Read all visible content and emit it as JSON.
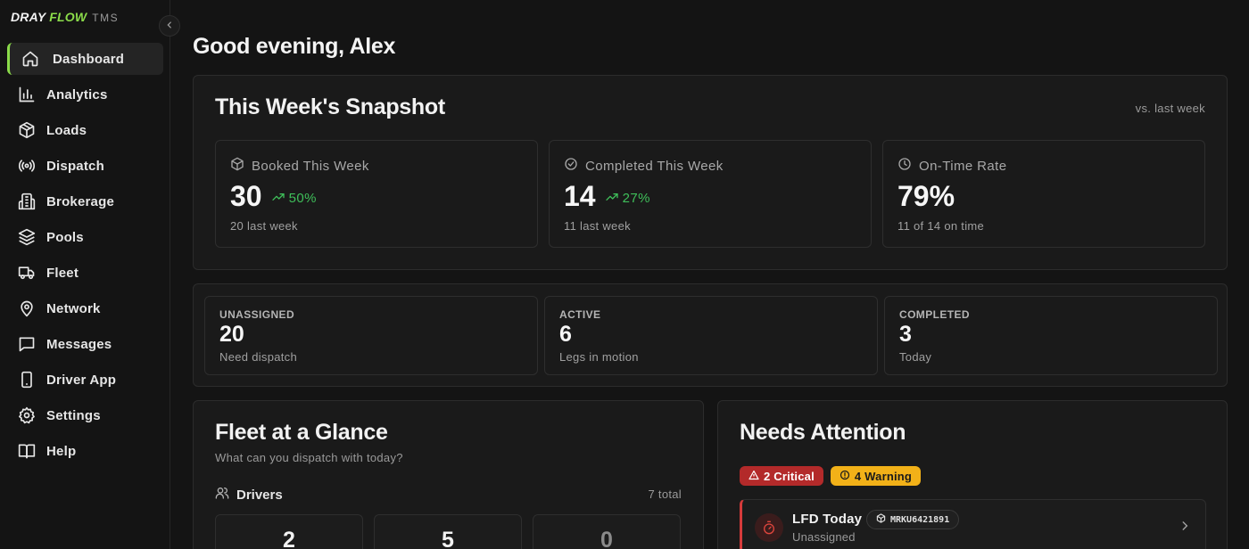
{
  "app": {
    "brand_part1": "DRAY ",
    "brand_part2": "FLOW",
    "product": "TMS",
    "accent_color": "#8bdc4a"
  },
  "sidebar": {
    "items": [
      {
        "label": "Dashboard",
        "icon": "home-icon",
        "active": true
      },
      {
        "label": "Analytics",
        "icon": "bar-chart-icon"
      },
      {
        "label": "Loads",
        "icon": "package-icon"
      },
      {
        "label": "Dispatch",
        "icon": "radio-icon"
      },
      {
        "label": "Brokerage",
        "icon": "building-icon"
      },
      {
        "label": "Pools",
        "icon": "layers-icon"
      },
      {
        "label": "Fleet",
        "icon": "truck-icon"
      },
      {
        "label": "Network",
        "icon": "map-pin-icon"
      },
      {
        "label": "Messages",
        "icon": "message-square-icon"
      },
      {
        "label": "Driver App",
        "icon": "smartphone-icon"
      },
      {
        "label": "Settings",
        "icon": "gear-icon"
      },
      {
        "label": "Help",
        "icon": "book-icon"
      }
    ]
  },
  "greeting": "Good evening, Alex",
  "snapshot": {
    "title": "This Week's Snapshot",
    "compare_label": "vs. last week",
    "cards": [
      {
        "label": "Booked This Week",
        "icon": "package-icon",
        "value": "30",
        "trend": "50%",
        "sub": "20 last week"
      },
      {
        "label": "Completed This Week",
        "icon": "check-circle-icon",
        "value": "14",
        "trend": "27%",
        "sub": "11 last week"
      },
      {
        "label": "On-Time Rate",
        "icon": "clock-icon",
        "value": "79%",
        "trend": "",
        "sub": "11 of 14 on time"
      }
    ],
    "trend_color": "#3fbf5a"
  },
  "stats": [
    {
      "label": "UNASSIGNED",
      "value": "20",
      "sub": "Need dispatch"
    },
    {
      "label": "ACTIVE",
      "value": "6",
      "sub": "Legs in motion"
    },
    {
      "label": "COMPLETED",
      "value": "3",
      "sub": "Today"
    }
  ],
  "fleet": {
    "title": "Fleet at a Glance",
    "subtitle": "What can you dispatch with today?",
    "drivers_label": "Drivers",
    "drivers_total": "7 total",
    "driver_counts": [
      "2",
      "5",
      "0"
    ]
  },
  "attention": {
    "title": "Needs Attention",
    "critical_badge": "2 Critical",
    "warning_badge": "4 Warning",
    "critical_color": "#b32a2a",
    "warning_color": "#f2b118",
    "alert": {
      "title": "LFD Today",
      "sub": "Unassigned",
      "container": "MRKU6421891"
    }
  }
}
